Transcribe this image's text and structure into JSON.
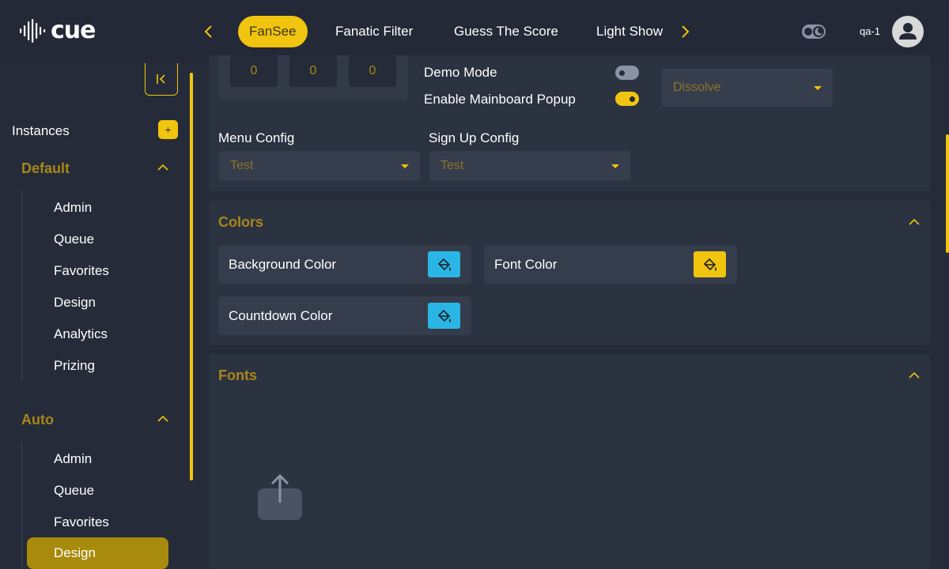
{
  "app": {
    "logo_text": "cue"
  },
  "nav": {
    "tabs": [
      {
        "label": "FanSee",
        "active": true
      },
      {
        "label": "Fanatic Filter",
        "active": false
      },
      {
        "label": "Guess The Score",
        "active": false
      },
      {
        "label": "Light Show",
        "active": false
      }
    ]
  },
  "user": {
    "name": "qa-1"
  },
  "sidebar": {
    "instances_label": "Instances",
    "add_label": "+",
    "groups": [
      {
        "title": "Default",
        "items": [
          "Admin",
          "Queue",
          "Favorites",
          "Design",
          "Analytics",
          "Prizing"
        ]
      },
      {
        "title": "Auto",
        "items": [
          "Admin",
          "Queue",
          "Favorites",
          "Design"
        ],
        "active_item": "Design"
      }
    ]
  },
  "settings": {
    "numbers": [
      "0",
      "0",
      "0"
    ],
    "demo_mode": {
      "label": "Demo Mode",
      "enabled": false
    },
    "mainboard_popup": {
      "label": "Enable Mainboard Popup",
      "enabled": true
    },
    "transition_select": {
      "value": "Dissolve"
    },
    "menu_config": {
      "label": "Menu Config",
      "value": "Test"
    },
    "signup_config": {
      "label": "Sign Up Config",
      "value": "Test"
    }
  },
  "colors": {
    "title": "Colors",
    "items": [
      {
        "label": "Background Color",
        "color": "#29b6e4"
      },
      {
        "label": "Font Color",
        "color": "#f1c40f"
      },
      {
        "label": "Countdown Color",
        "color": "#29b6e4"
      }
    ]
  },
  "fonts": {
    "title": "Fonts"
  },
  "theme": {
    "accent": "#f1c40f",
    "accent_dark": "#a8861a",
    "background": "#252b38",
    "panel": "#2b3240"
  }
}
